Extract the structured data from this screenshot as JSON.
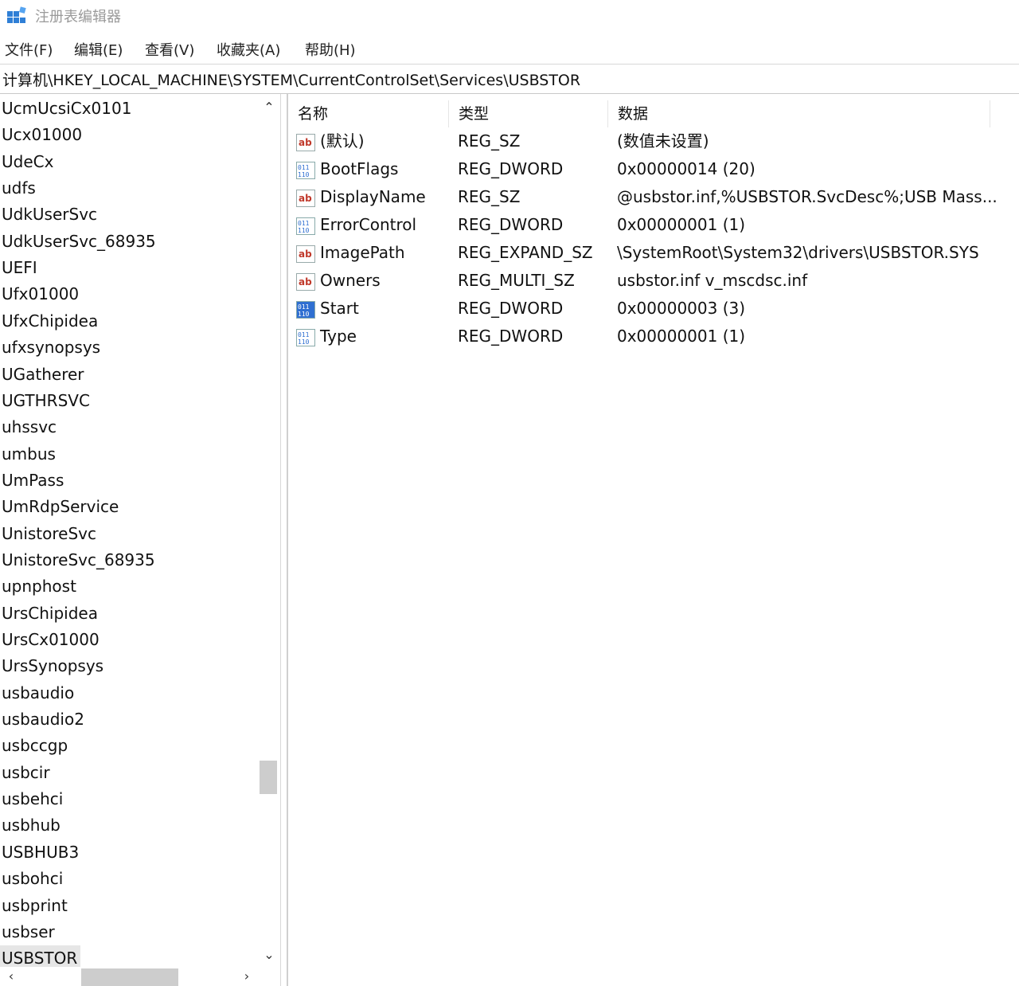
{
  "window": {
    "title": "注册表编辑器"
  },
  "menu": [
    "文件(F)",
    "编辑(E)",
    "查看(V)",
    "收藏夹(A)",
    "帮助(H)"
  ],
  "address": "计算机\\HKEY_LOCAL_MACHINE\\SYSTEM\\CurrentControlSet\\Services\\USBSTOR",
  "tree": {
    "items": [
      "UcmUcsiCx0101",
      "Ucx01000",
      "UdeCx",
      "udfs",
      "UdkUserSvc",
      "UdkUserSvc_68935",
      "UEFI",
      "Ufx01000",
      "UfxChipidea",
      "ufxsynopsys",
      "UGatherer",
      "UGTHRSVC",
      "uhssvc",
      "umbus",
      "UmPass",
      "UmRdpService",
      "UnistoreSvc",
      "UnistoreSvc_68935",
      "upnphost",
      "UrsChipidea",
      "UrsCx01000",
      "UrsSynopsys",
      "usbaudio",
      "usbaudio2",
      "usbccgp",
      "usbcir",
      "usbehci",
      "usbhub",
      "USBHUB3",
      "usbohci",
      "usbprint",
      "usbser",
      "USBSTOR"
    ],
    "selected_index": 32
  },
  "list": {
    "columns": [
      "名称",
      "类型",
      "数据"
    ],
    "rows": [
      {
        "icon": "string-value-icon",
        "name": "(默认)",
        "type": "REG_SZ",
        "data": "(数值未设置)"
      },
      {
        "icon": "binary-value-icon",
        "name": "BootFlags",
        "type": "REG_DWORD",
        "data": "0x00000014 (20)"
      },
      {
        "icon": "string-value-icon",
        "name": "DisplayName",
        "type": "REG_SZ",
        "data": "@usbstor.inf,%USBSTOR.SvcDesc%;USB Mass..."
      },
      {
        "icon": "binary-value-icon",
        "name": "ErrorControl",
        "type": "REG_DWORD",
        "data": "0x00000001 (1)"
      },
      {
        "icon": "string-value-icon",
        "name": "ImagePath",
        "type": "REG_EXPAND_SZ",
        "data": "\\SystemRoot\\System32\\drivers\\USBSTOR.SYS"
      },
      {
        "icon": "string-value-icon",
        "name": "Owners",
        "type": "REG_MULTI_SZ",
        "data": "usbstor.inf v_mscdsc.inf"
      },
      {
        "icon": "binary-value-icon",
        "name": "Start",
        "type": "REG_DWORD",
        "data": "0x00000003 (3)",
        "highlighted": true
      },
      {
        "icon": "binary-value-icon",
        "name": "Type",
        "type": "REG_DWORD",
        "data": "0x00000001 (1)"
      }
    ]
  },
  "colors": {
    "selection": "#e6e6e6",
    "icon_red": "#c0392b",
    "icon_blue": "#2f6fd1",
    "scrollbar_thumb": "#cdcdcd"
  }
}
